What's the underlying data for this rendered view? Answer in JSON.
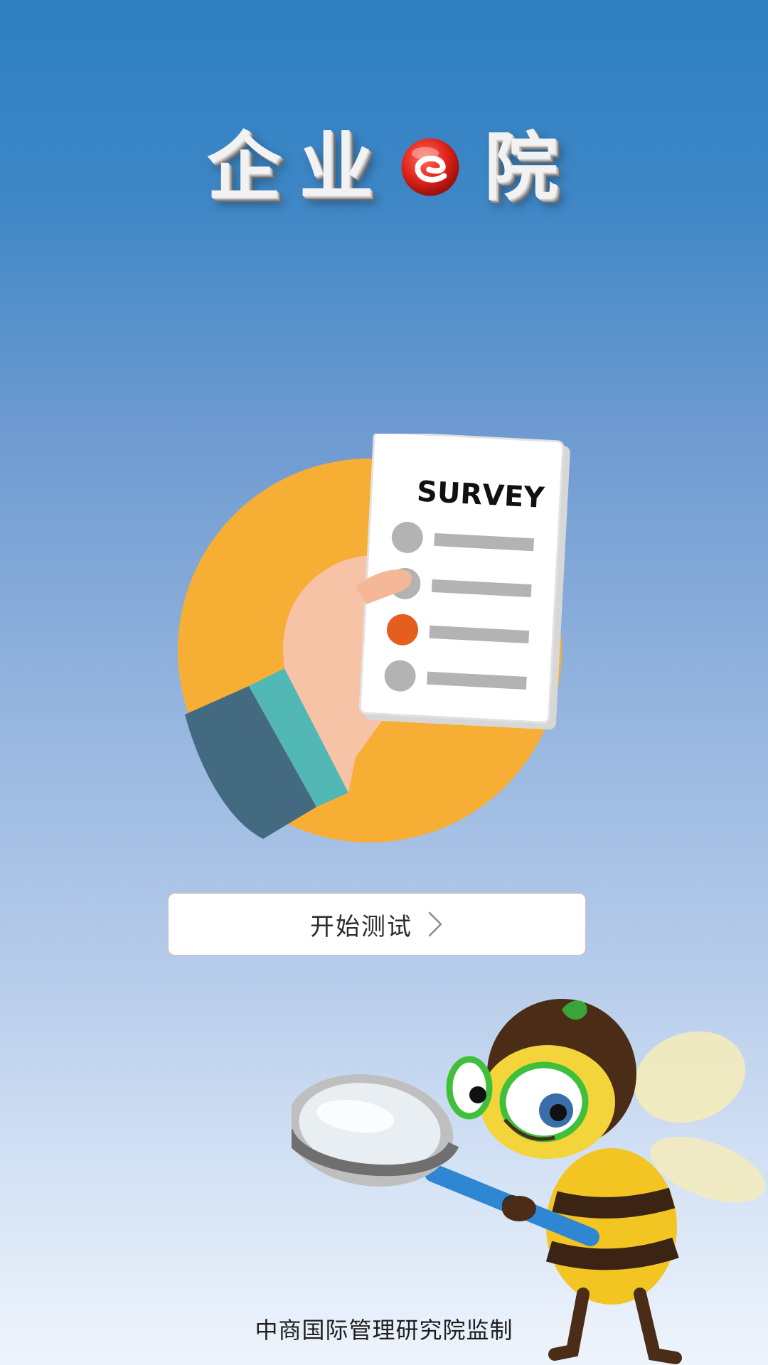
{
  "header": {
    "title_chars": [
      "企",
      "业",
      "院"
    ],
    "logo_icon": "e-logo-icon"
  },
  "illustration": {
    "survey_heading": "SURVEY",
    "icon": "survey-clipboard-icon",
    "colors": {
      "circle": "#f7ae35",
      "sleeve": "#446a82",
      "cuff": "#52b8b6",
      "hand": "#f6c3a6",
      "option_default": "#b3b3b3",
      "option_selected": "#e45e1f"
    }
  },
  "start_button": {
    "label": "开始测试",
    "icon": "chevron-right-icon"
  },
  "mascot": {
    "icon": "bee-magnifier-mascot-icon"
  },
  "footer": {
    "text": "中商国际管理研究院监制"
  }
}
